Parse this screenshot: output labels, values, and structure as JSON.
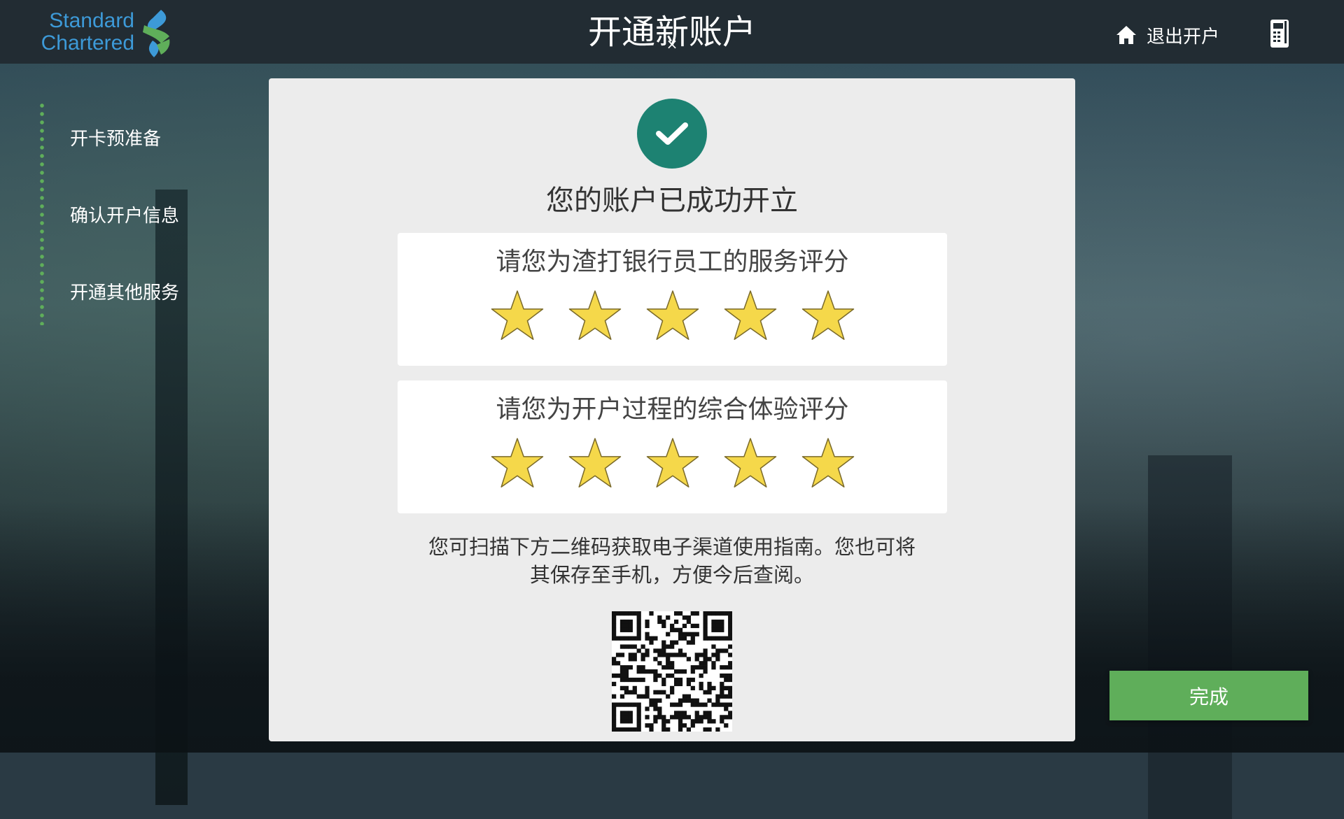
{
  "header": {
    "logo_line1": "Standard",
    "logo_line2": "Chartered",
    "title": "开通新账户",
    "close_symbol": "×",
    "exit_label": "退出开户",
    "home_icon": "home-icon",
    "device_icon": "card-reader-icon"
  },
  "sidebar": {
    "steps": [
      {
        "label": "开卡预准备"
      },
      {
        "label": "确认开户信息"
      },
      {
        "label": "开通其他服务"
      }
    ]
  },
  "card": {
    "success_title": "您的账户已成功开立",
    "ratings": [
      {
        "label": "请您为渣打银行员工的服务评分",
        "stars": 5,
        "max": 5
      },
      {
        "label": "请您为开户过程的综合体验评分",
        "stars": 5,
        "max": 5
      }
    ],
    "hint_line1": "您可扫描下方二维码获取电子渠道使用指南。您也可将",
    "hint_line2": "其保存至手机，方便今后查阅。"
  },
  "footer": {
    "done_label": "完成"
  },
  "colors": {
    "header_bg": "#222c33",
    "brand_blue": "#3d9ad8",
    "brand_green": "#5fae5a",
    "success_teal": "#1d8272",
    "star_fill": "#f5d84a"
  }
}
